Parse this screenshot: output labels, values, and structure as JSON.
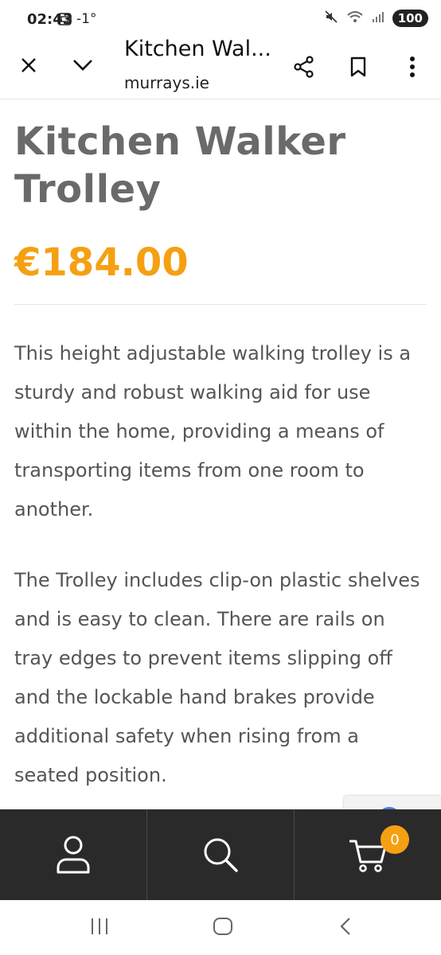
{
  "status_bar": {
    "time": "02:43",
    "temperature": "-1°",
    "battery": "100"
  },
  "browser": {
    "title": "Kitchen Wal...",
    "url": "murrays.ie"
  },
  "product": {
    "title": "Kitchen Walker Trolley",
    "price": "€184.00",
    "description_1": "This height adjustable walking trolley is a sturdy and robust walking aid for use within the home, providing a means of transporting items from one room to another.",
    "description_2": "The Trolley includes clip-on plastic shelves and is easy to clean. There are rails on tray edges to prevent items slipping off and the lockable hand brakes provide additional safety when rising from a seated position."
  },
  "bottom_nav": {
    "cart_count": "0"
  },
  "colors": {
    "accent": "#f5a013",
    "title_gray": "#6a6a6a",
    "nav_dark": "#2a2a2a"
  },
  "icons": [
    "close-icon",
    "chevron-down-icon",
    "share-icon",
    "bookmark-icon",
    "more-vert-icon",
    "account-icon",
    "search-icon",
    "cart-icon",
    "recent-apps-icon",
    "home-icon",
    "back-icon"
  ]
}
